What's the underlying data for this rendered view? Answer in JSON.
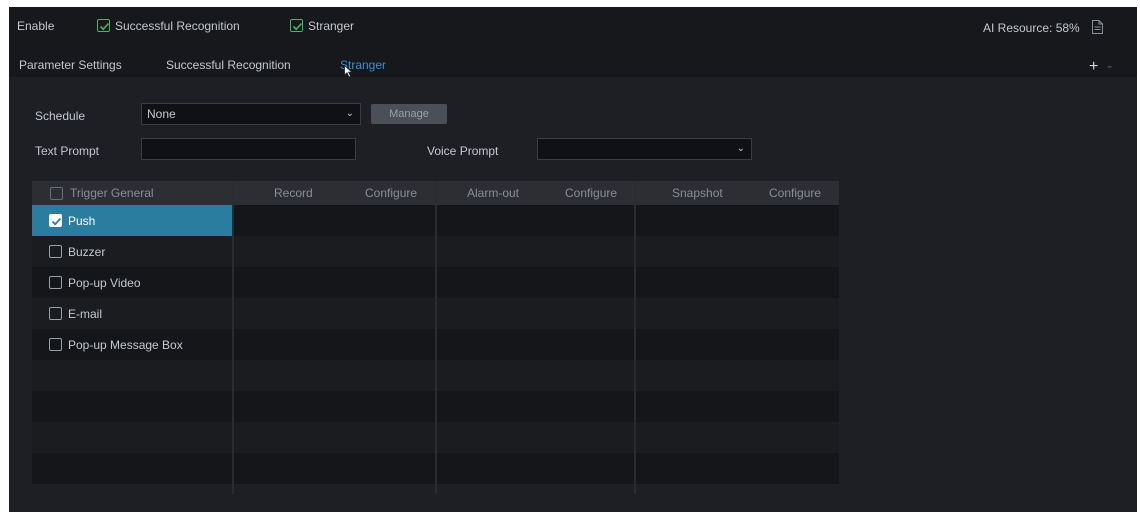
{
  "header": {
    "enable_label": "Enable",
    "successful_recognition_label": "Successful Recognition",
    "stranger_label": "Stranger",
    "ai_resource": "AI Resource: 58%"
  },
  "tabs": [
    {
      "label": "Parameter Settings"
    },
    {
      "label": "Successful Recognition"
    },
    {
      "label": "Stranger"
    }
  ],
  "form": {
    "schedule_label": "Schedule",
    "schedule_value": "None",
    "manage_label": "Manage",
    "text_prompt_label": "Text Prompt",
    "text_prompt_value": "",
    "voice_prompt_label": "Voice Prompt",
    "voice_prompt_value": ""
  },
  "trigger": {
    "header": "Trigger General",
    "items": [
      {
        "label": "Push",
        "checked": true
      },
      {
        "label": "Buzzer",
        "checked": false
      },
      {
        "label": "Pop-up Video",
        "checked": false
      },
      {
        "label": "E-mail",
        "checked": false
      },
      {
        "label": "Pop-up Message Box",
        "checked": false
      }
    ]
  },
  "panels": [
    {
      "title": "Record",
      "action": "Configure"
    },
    {
      "title": "Alarm-out",
      "action": "Configure"
    },
    {
      "title": "Snapshot",
      "action": "Configure"
    }
  ],
  "colors": {
    "accent": "#3a8fd8",
    "selected_row": "#2a7d9e",
    "checkbox_green": "#3fb86a"
  }
}
